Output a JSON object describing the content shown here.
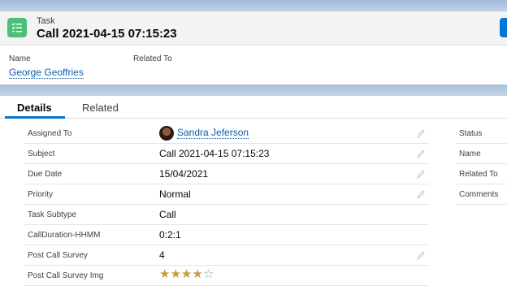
{
  "header": {
    "eyebrow": "Task",
    "title": "Call 2021-04-15 07:15:23",
    "icon": "task-checklist-icon",
    "accent": "#0176d3",
    "icon_color": "#4bc076"
  },
  "highlights": {
    "name_label": "Name",
    "name_value": "George Geoffries",
    "related_label": "Related To"
  },
  "tabs": [
    {
      "label": "Details",
      "active": true
    },
    {
      "label": "Related",
      "active": false
    }
  ],
  "details": {
    "rows": [
      {
        "label": "Assigned To",
        "value": "Sandra Jeferson",
        "link": true,
        "avatar": true,
        "editable": true
      },
      {
        "label": "Subject",
        "value": "Call 2021-04-15 07:15:23",
        "editable": true
      },
      {
        "label": "Due Date",
        "value": "15/04/2021",
        "editable": true
      },
      {
        "label": "Priority",
        "value": "Normal",
        "editable": true
      },
      {
        "label": "Task Subtype",
        "value": "Call",
        "editable": false
      },
      {
        "label": "CallDuration-HHMM",
        "value": "0:2:1",
        "editable": false
      },
      {
        "label": "Post Call Survey",
        "value": "4",
        "editable": true
      },
      {
        "label": "Post Call Survey Img",
        "rating": 4,
        "rating_max": 5,
        "editable": false
      }
    ]
  },
  "right_column": {
    "labels": [
      "Status",
      "Name",
      "Related To",
      "Comments"
    ]
  }
}
